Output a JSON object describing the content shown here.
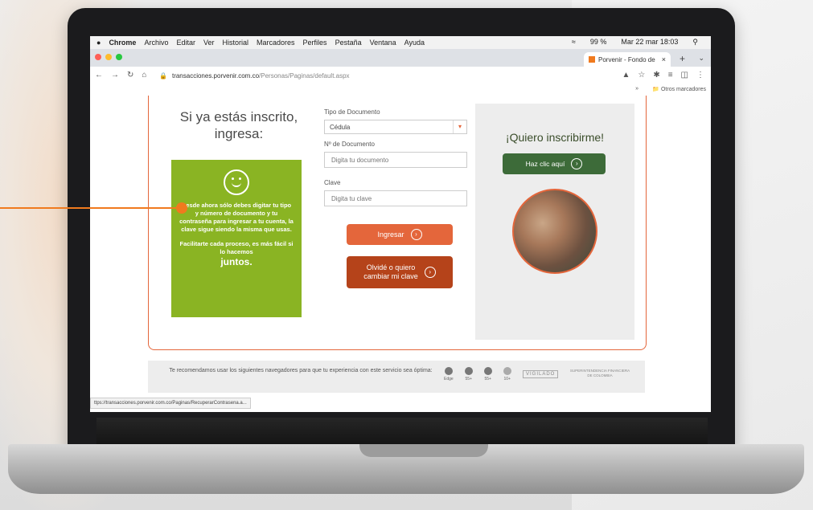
{
  "mac_menubar": {
    "app": "Chrome",
    "items": [
      "Archivo",
      "Editar",
      "Ver",
      "Historial",
      "Marcadores",
      "Perfiles",
      "Pestaña",
      "Ventana",
      "Ayuda"
    ],
    "battery": "99 %",
    "datetime": "Mar 22 mar 18:03"
  },
  "browser": {
    "tab_title": "Porvenir - Fondo de",
    "url_host": "transacciones.porvenir.com.co",
    "url_path": "/Personas/Paginas/default.aspx",
    "bookmarks_other": "Otros marcadores",
    "status_url": "ttps://transacciones.porvenir.com.co/Paginas/RecuperarContrasena.a..."
  },
  "login": {
    "title_line1": "Si ya estás inscrito,",
    "title_line2": "ingresa:",
    "doc_type_label": "Tipo de Documento",
    "doc_type_value": "Cédula",
    "doc_number_label": "Nº de Documento",
    "doc_number_placeholder": "Digita tu documento",
    "password_label": "Clave",
    "password_placeholder": "Digita tu clave",
    "login_button": "Ingresar",
    "forgot_button_line1": "Olvidé o quiero",
    "forgot_button_line2": "cambiar mi clave"
  },
  "info_box": {
    "text1": "Desde ahora sólo debes digitar tu tipo y número de documento y tu contraseña para ingresar a tu cuenta, la clave sigue siendo la misma que usas.",
    "text2": "Facilitarte cada proceso, es más fácil si lo hacemos",
    "text3": "juntos."
  },
  "signup": {
    "title": "¡Quiero inscribirme!",
    "button": "Haz clic aquí"
  },
  "footer": {
    "recommend": "Te recomendamos usar los siguientes navegadores para que tu experiencia con este servicio sea óptima:",
    "browsers": [
      "Edge",
      "55+",
      "55+",
      "10+"
    ],
    "vigilado": "VIGILADO",
    "superfinanciera": "SUPERINTENDENCIA FINANCIERA DE COLOMBIA"
  },
  "colors": {
    "accent_orange": "#e4663b",
    "green_box": "#8ab423",
    "signup_button": "#3d6b39",
    "forgot_button": "#b5431a"
  }
}
